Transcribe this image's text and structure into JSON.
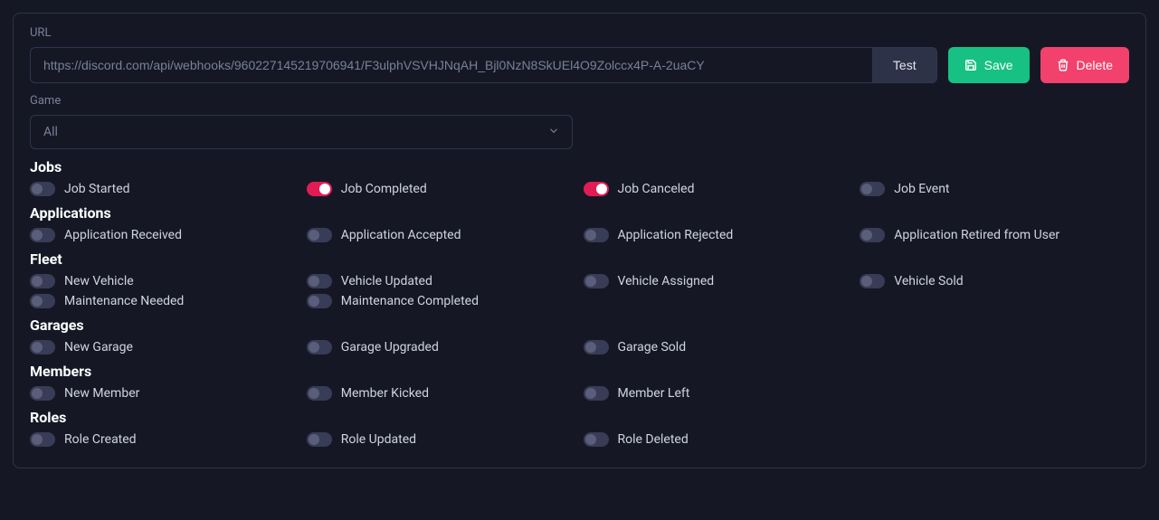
{
  "url": {
    "label": "URL",
    "value": "https://discord.com/api/webhooks/960227145219706941/F3ulphVSVHJNqAH_Bjl0NzN8SkUEl4O9Zolccx4P-A-2uaCY",
    "test_label": "Test"
  },
  "actions": {
    "save_label": "Save",
    "delete_label": "Delete"
  },
  "game": {
    "label": "Game",
    "selected": "All"
  },
  "sections": {
    "jobs": {
      "title": "Jobs",
      "items": [
        {
          "label": "Job Started",
          "on": false
        },
        {
          "label": "Job Completed",
          "on": true
        },
        {
          "label": "Job Canceled",
          "on": true
        },
        {
          "label": "Job Event",
          "on": false
        }
      ]
    },
    "applications": {
      "title": "Applications",
      "items": [
        {
          "label": "Application Received",
          "on": false
        },
        {
          "label": "Application Accepted",
          "on": false
        },
        {
          "label": "Application Rejected",
          "on": false
        },
        {
          "label": "Application Retired from User",
          "on": false
        }
      ]
    },
    "fleet": {
      "title": "Fleet",
      "items": [
        {
          "label": "New Vehicle",
          "on": false
        },
        {
          "label": "Vehicle Updated",
          "on": false
        },
        {
          "label": "Vehicle Assigned",
          "on": false
        },
        {
          "label": "Vehicle Sold",
          "on": false
        },
        {
          "label": "Maintenance Needed",
          "on": false
        },
        {
          "label": "Maintenance Completed",
          "on": false
        }
      ]
    },
    "garages": {
      "title": "Garages",
      "items": [
        {
          "label": "New Garage",
          "on": false
        },
        {
          "label": "Garage Upgraded",
          "on": false
        },
        {
          "label": "Garage Sold",
          "on": false
        }
      ]
    },
    "members": {
      "title": "Members",
      "items": [
        {
          "label": "New Member",
          "on": false
        },
        {
          "label": "Member Kicked",
          "on": false
        },
        {
          "label": "Member Left",
          "on": false
        }
      ]
    },
    "roles": {
      "title": "Roles",
      "items": [
        {
          "label": "Role Created",
          "on": false
        },
        {
          "label": "Role Updated",
          "on": false
        },
        {
          "label": "Role Deleted",
          "on": false
        }
      ]
    }
  }
}
